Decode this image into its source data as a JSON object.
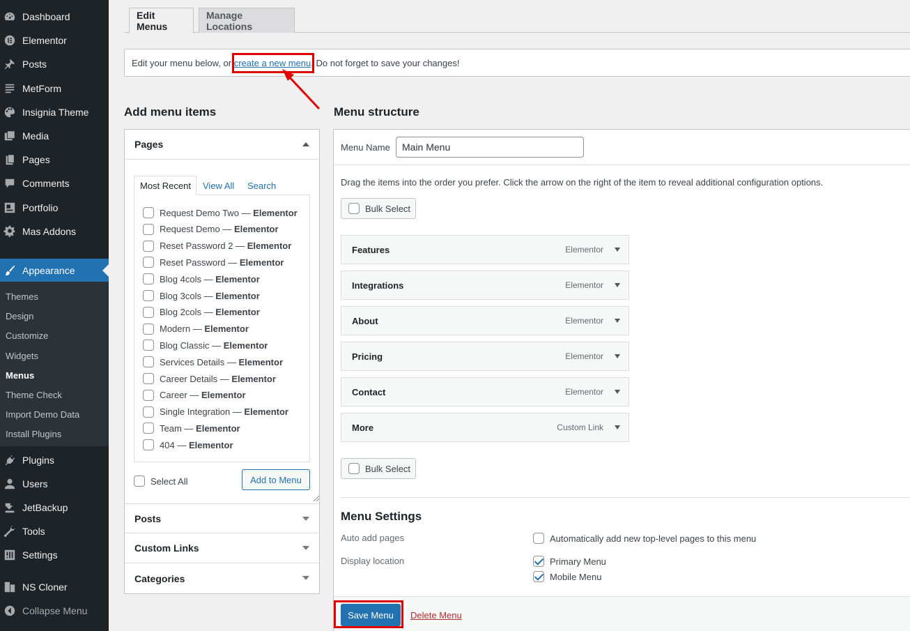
{
  "sidebar": {
    "items": [
      {
        "label": "Dashboard",
        "icon": "dashboard-icon"
      },
      {
        "label": "Elementor",
        "icon": "elementor-icon"
      },
      {
        "label": "Posts",
        "icon": "pin-icon"
      },
      {
        "label": "MetForm",
        "icon": "form-icon"
      },
      {
        "label": "Insignia Theme",
        "icon": "palette-icon"
      },
      {
        "label": "Media",
        "icon": "media-icon"
      },
      {
        "label": "Pages",
        "icon": "pages-icon"
      },
      {
        "label": "Comments",
        "icon": "comment-icon"
      },
      {
        "label": "Portfolio",
        "icon": "portfolio-icon"
      },
      {
        "label": "Mas Addons",
        "icon": "gear-icon"
      },
      {
        "label": "Appearance",
        "icon": "brush-icon"
      },
      {
        "label": "Plugins",
        "icon": "plug-icon"
      },
      {
        "label": "Users",
        "icon": "user-icon"
      },
      {
        "label": "JetBackup",
        "icon": "backup-icon"
      },
      {
        "label": "Tools",
        "icon": "wrench-icon"
      },
      {
        "label": "Settings",
        "icon": "settings-icon"
      },
      {
        "label": "NS Cloner",
        "icon": "clone-icon"
      },
      {
        "label": "Collapse Menu",
        "icon": "collapse-icon"
      }
    ],
    "submenu": [
      "Themes",
      "Design",
      "Customize",
      "Widgets",
      "Menus",
      "Theme Check",
      "Import Demo Data",
      "Install Plugins"
    ]
  },
  "tabs": {
    "edit": "Edit Menus",
    "manage": "Manage Locations"
  },
  "notice": {
    "before": "Edit your menu below, or ",
    "link": "create a new menu",
    "after": ". Do not forget to save your changes!"
  },
  "add_items": {
    "heading": "Add menu items",
    "pages_title": "Pages",
    "subtabs": [
      "Most Recent",
      "View All",
      "Search"
    ],
    "pages": [
      {
        "name": "Request Demo Two",
        "suffix": "Elementor"
      },
      {
        "name": "Request Demo",
        "suffix": "Elementor"
      },
      {
        "name": "Reset Password 2",
        "suffix": "Elementor"
      },
      {
        "name": "Reset Password",
        "suffix": "Elementor"
      },
      {
        "name": "Blog 4cols",
        "suffix": "Elementor"
      },
      {
        "name": "Blog 3cols",
        "suffix": "Elementor"
      },
      {
        "name": "Blog 2cols",
        "suffix": "Elementor"
      },
      {
        "name": "Modern",
        "suffix": "Elementor"
      },
      {
        "name": "Blog Classic",
        "suffix": "Elementor"
      },
      {
        "name": "Services Details",
        "suffix": "Elementor"
      },
      {
        "name": "Career Details",
        "suffix": "Elementor"
      },
      {
        "name": "Career",
        "suffix": "Elementor"
      },
      {
        "name": "Single Integration",
        "suffix": "Elementor"
      },
      {
        "name": "Team",
        "suffix": "Elementor"
      },
      {
        "name": "404",
        "suffix": "Elementor"
      }
    ],
    "dash": " — ",
    "select_all": "Select All",
    "add_button": "Add to Menu",
    "other_sections": [
      "Posts",
      "Custom Links",
      "Categories"
    ]
  },
  "structure": {
    "heading": "Menu structure",
    "name_label": "Menu Name",
    "name_value": "Main Menu",
    "instructions": "Drag the items into the order you prefer. Click the arrow on the right of the item to reveal additional configuration options.",
    "bulk_select": "Bulk Select",
    "items": [
      {
        "title": "Features",
        "type": "Elementor"
      },
      {
        "title": "Integrations",
        "type": "Elementor"
      },
      {
        "title": "About",
        "type": "Elementor"
      },
      {
        "title": "Pricing",
        "type": "Elementor"
      },
      {
        "title": "Contact",
        "type": "Elementor"
      },
      {
        "title": "More",
        "type": "Custom Link"
      }
    ]
  },
  "settings": {
    "heading": "Menu Settings",
    "auto_add_label": "Auto add pages",
    "auto_add_option": "Automatically add new top-level pages to this menu",
    "auto_add_checked": false,
    "display_label": "Display location",
    "locations": [
      {
        "label": "Primary Menu",
        "checked": true
      },
      {
        "label": "Mobile Menu",
        "checked": true
      }
    ]
  },
  "footer": {
    "save": "Save Menu",
    "delete": "Delete Menu"
  },
  "colors": {
    "accent": "#2271b1",
    "highlight": "#e00000",
    "sidebar": "#1d2327",
    "delete": "#b32d2e"
  }
}
